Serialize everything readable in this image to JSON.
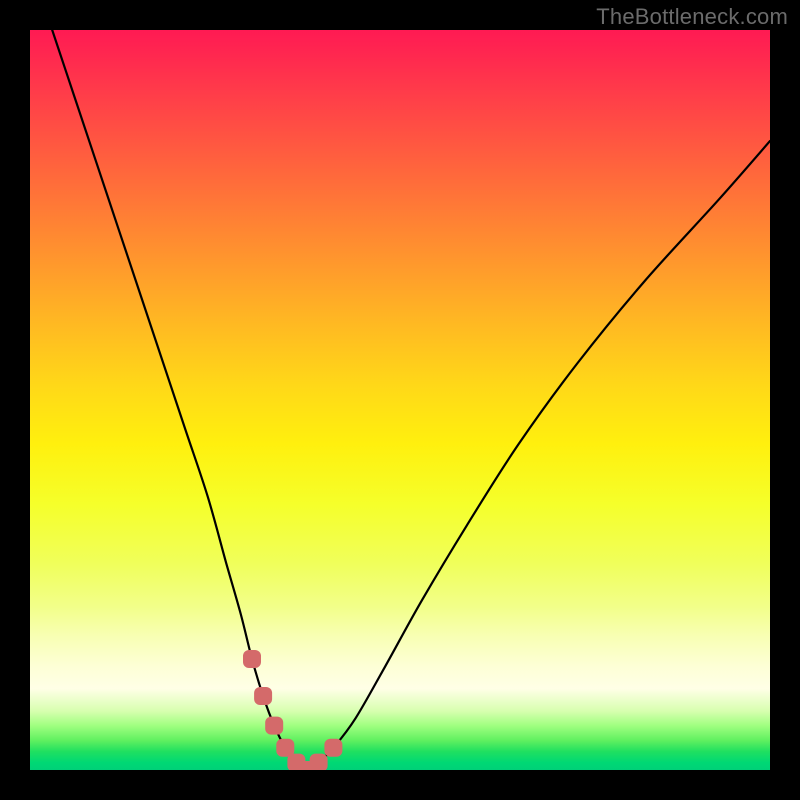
{
  "watermark": "TheBottleneck.com",
  "colors": {
    "frame": "#000000",
    "curve": "#000000",
    "marker": "#d46a6a"
  },
  "chart_data": {
    "type": "line",
    "title": "",
    "xlabel": "",
    "ylabel": "",
    "xlim": [
      0,
      100
    ],
    "ylim": [
      0,
      100
    ],
    "grid": false,
    "legend": false,
    "series": [
      {
        "name": "bottleneck-curve",
        "x": [
          3,
          6,
          9,
          12,
          15,
          18,
          21,
          24,
          26.5,
          28.5,
          30,
          31.5,
          33,
          34.5,
          36,
          37.5,
          39,
          41,
          44,
          48,
          53,
          59,
          66,
          74,
          83,
          93,
          100
        ],
        "y": [
          100,
          91,
          82,
          73,
          64,
          55,
          46,
          37,
          28,
          21,
          15,
          10,
          6,
          3,
          1,
          0,
          1,
          3,
          7,
          14,
          23,
          33,
          44,
          55,
          66,
          77,
          85
        ]
      },
      {
        "name": "highlight-markers",
        "x": [
          30,
          31.5,
          33,
          34.5,
          36,
          37.5,
          39,
          41
        ],
        "y": [
          15,
          10,
          6,
          3,
          1,
          0,
          1,
          3
        ]
      }
    ]
  }
}
